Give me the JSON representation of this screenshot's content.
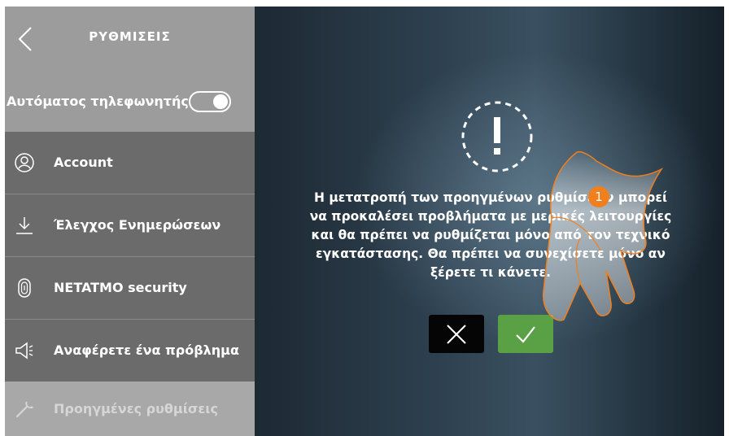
{
  "sidebar": {
    "title": "ΡΥΘΜΙΣΕΙΣ",
    "auto_answer": {
      "label": "Αυτόματος τηλεφωνητής",
      "toggle_on": true
    },
    "items": [
      {
        "label": "Account",
        "icon": "user-circle-icon"
      },
      {
        "label": "Έλεγχος Ενημερώσεων",
        "icon": "download-icon"
      },
      {
        "label": "NETATMO security",
        "icon": "fingerprint-icon"
      },
      {
        "label": "Αναφέρετε ένα πρόβλημα",
        "icon": "megaphone-icon"
      },
      {
        "label": "Προηγμένες ρυθμίσεις",
        "icon": "wrench-icon"
      }
    ]
  },
  "dialog": {
    "icon": "warning-icon",
    "message_lines": [
      "Η μετατροπή των προηγμένων ρυθμίσεων μπορεί",
      "να προκαλέσει προβλήματα με μερικές λειτουργίες",
      "και θα πρέπει να ρυθμίζεται μόνο από τον τεχνικό",
      "εγκατάστασης. Θα πρέπει να συνεχίσετε μόνο αν",
      "ξέρετε τι κάνετε."
    ],
    "cancel_icon": "close-icon",
    "confirm_icon": "check-icon"
  },
  "annotation": {
    "step": "1"
  },
  "colors": {
    "confirm": "#5aa045",
    "cancel": "#050505",
    "badge": "#f07f1e",
    "sidebar_light": "#9c9c9c",
    "sidebar_dark": "#6b6b6b"
  }
}
